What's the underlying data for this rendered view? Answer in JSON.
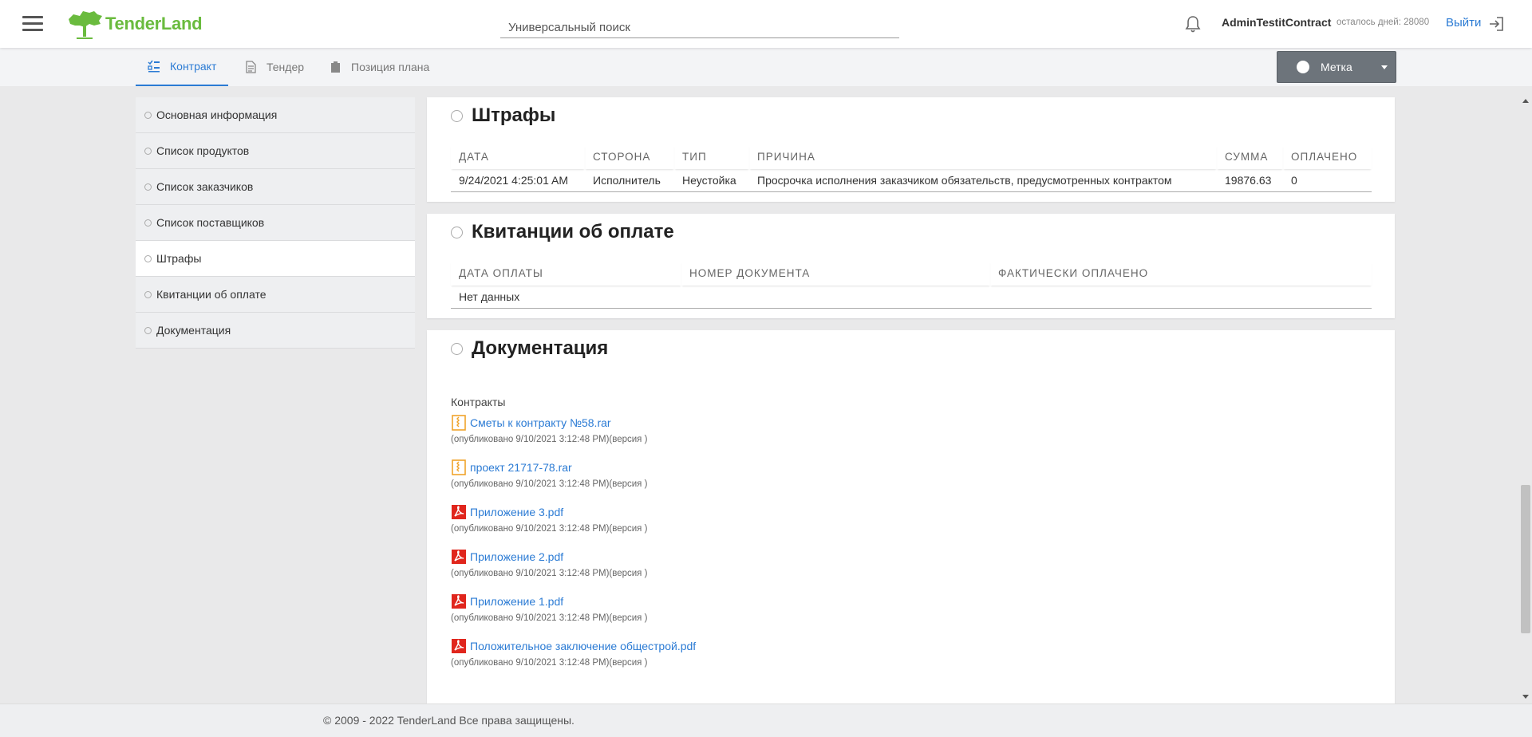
{
  "header": {
    "logo_text": "TenderLand",
    "search_placeholder": "Универсальный поиск",
    "username": "AdminTestitContract",
    "days_left": "осталось дней: 28080",
    "logout_label": "Выйти"
  },
  "tabs": [
    {
      "label": "Контракт",
      "icon": "checklist-icon",
      "active": true
    },
    {
      "label": "Тендер",
      "icon": "document-icon"
    },
    {
      "label": "Позиция плана",
      "icon": "clipboard-icon"
    }
  ],
  "mark_button": {
    "label": "Метка"
  },
  "sidebar": {
    "items": [
      {
        "label": "Основная информация"
      },
      {
        "label": "Список продуктов"
      },
      {
        "label": "Список заказчиков"
      },
      {
        "label": "Список поставщиков"
      },
      {
        "label": "Штрафы",
        "active": true
      },
      {
        "label": "Квитанции об оплате"
      },
      {
        "label": "Документация"
      }
    ]
  },
  "fines": {
    "title": "Штрафы",
    "columns": [
      "ДАТА",
      "СТОРОНА",
      "ТИП",
      "ПРИЧИНА",
      "СУММА",
      "ОПЛАЧЕНО"
    ],
    "rows": [
      [
        "9/24/2021 4:25:01 AM",
        "Исполнитель",
        "Неустойка",
        "Просрочка исполнения заказчиком обязательств, предусмотренных контрактом",
        "19876.63",
        "0"
      ]
    ]
  },
  "receipts": {
    "title": "Квитанции об оплате",
    "columns": [
      "ДАТА ОПЛАТЫ",
      "НОМЕР ДОКУМЕНТА",
      "ФАКТИЧЕСКИ ОПЛАЧЕНО"
    ],
    "empty_text": "Нет данных"
  },
  "documentation": {
    "title": "Документация",
    "group_label": "Контракты",
    "files": [
      {
        "name": "Сметы к контракту №58.rar",
        "icon": "archive-icon",
        "meta": "(опубликовано 9/10/2021 3:12:48 PM)(версия )"
      },
      {
        "name": "проект 21717-78.rar",
        "icon": "archive-icon",
        "meta": "(опубликовано 9/10/2021 3:12:48 PM)(версия )"
      },
      {
        "name": "Приложение 3.pdf",
        "icon": "pdf-icon",
        "meta": "(опубликовано 9/10/2021 3:12:48 PM)(версия )"
      },
      {
        "name": "Приложение 2.pdf",
        "icon": "pdf-icon",
        "meta": "(опубликовано 9/10/2021 3:12:48 PM)(версия )"
      },
      {
        "name": "Приложение 1.pdf",
        "icon": "pdf-icon",
        "meta": "(опубликовано 9/10/2021 3:12:48 PM)(версия )"
      },
      {
        "name": "Положительное заключение общестрой.pdf",
        "icon": "pdf-icon",
        "meta": "(опубликовано 9/10/2021 3:12:48 PM)(версия )"
      }
    ]
  },
  "footer": {
    "copyright": "© 2009 - 2022 TenderLand Все права защищены."
  },
  "colors": {
    "brand_green": "#6abb3e",
    "link_blue": "#2b7bd4",
    "pdf_red": "#e0261d",
    "archive_orange": "#f0a32b"
  }
}
